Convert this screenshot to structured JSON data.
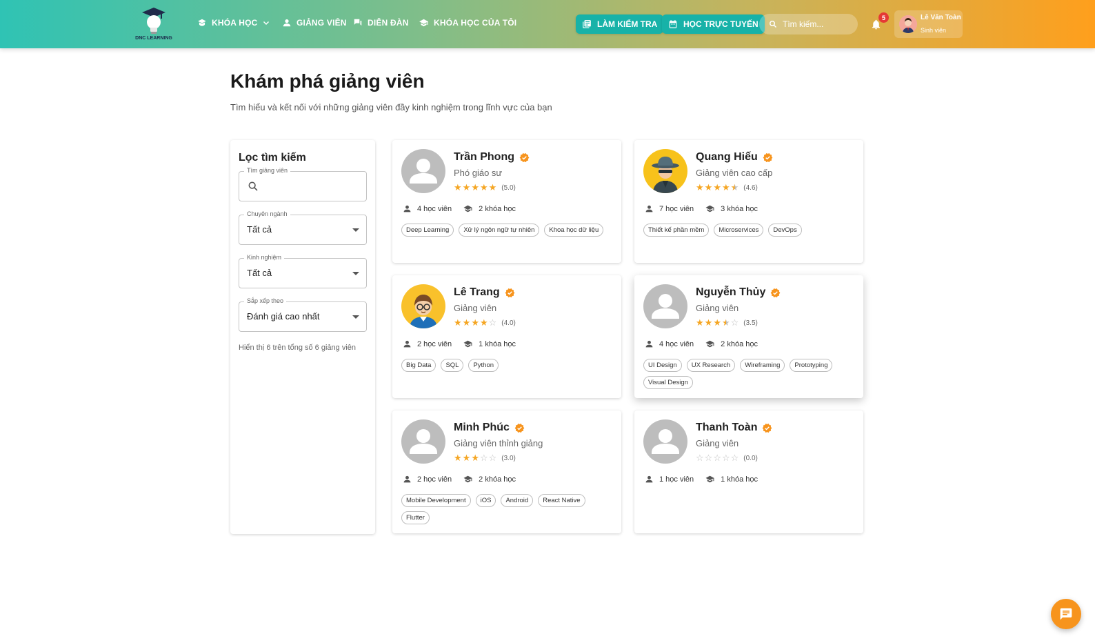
{
  "header": {
    "logo_text": "DNC LEARNING",
    "nav": [
      {
        "label": "KHÓA HỌC",
        "icon": "book-icon",
        "has_dropdown": true
      },
      {
        "label": "GIẢNG VIÊN",
        "icon": "person-icon"
      },
      {
        "label": "DIỄN ĐÀN",
        "icon": "forum-icon"
      },
      {
        "label": "KHÓA HỌC CỦA TÔI",
        "icon": "school-icon"
      }
    ],
    "btn_test": "LÀM KIỂM TRA",
    "btn_online": "HỌC TRỰC TUYẾN",
    "search_placeholder": "Tìm kiếm...",
    "notification_count": "5",
    "user": {
      "name": "Lê Văn Toàn",
      "role": "Sinh viên"
    }
  },
  "page": {
    "title": "Khám phá giảng viên",
    "subtitle": "Tìm hiểu và kết nối với những giảng viên đầy kinh nghiệm trong lĩnh vực của bạn"
  },
  "filter": {
    "title": "Lọc tìm kiếm",
    "search_label": "Tìm giảng viên",
    "specialty_label": "Chuyên ngành",
    "specialty_value": "Tất cả",
    "experience_label": "Kinh nghiệm",
    "experience_value": "Tất cả",
    "sort_label": "Sắp xếp theo",
    "sort_value": "Đánh giá cao nhất",
    "count_text": "Hiển thị 6 trên tổng số 6 giảng viên"
  },
  "colors": {
    "accent": "#f7941d",
    "star": "#f5a623",
    "teal": "#17b2a8"
  },
  "instructors": [
    {
      "name": "Trần Phong",
      "title": "Phó giáo sư",
      "rating": 5.0,
      "rating_text": "(5.0)",
      "students": "4 học viên",
      "courses": "2 khóa học",
      "tags": [
        "Deep Learning",
        "Xử lý ngôn ngữ tự nhiên",
        "Khoa học dữ liệu"
      ],
      "avatar": "generic"
    },
    {
      "name": "Quang Hiếu",
      "title": "Giảng viên cao cấp",
      "rating": 4.6,
      "rating_text": "(4.6)",
      "students": "7 học viên",
      "courses": "3 khóa học",
      "tags": [
        "Thiết kế phần mềm",
        "Microservices",
        "DevOps"
      ],
      "avatar": "spy"
    },
    {
      "name": "Lê Trang",
      "title": "Giảng viên",
      "rating": 4.0,
      "rating_text": "(4.0)",
      "students": "2 học viên",
      "courses": "1 khóa học",
      "tags": [
        "Big Data",
        "SQL",
        "Python"
      ],
      "avatar": "glasses"
    },
    {
      "name": "Nguyễn Thủy",
      "title": "Giảng viên",
      "rating": 3.5,
      "rating_text": "(3.5)",
      "students": "4 học viên",
      "courses": "2 khóa học",
      "tags": [
        "UI Design",
        "UX Research",
        "Wireframing",
        "Prototyping",
        "Visual Design"
      ],
      "avatar": "generic"
    },
    {
      "name": "Minh Phúc",
      "title": "Giảng viên thỉnh giảng",
      "rating": 3.0,
      "rating_text": "(3.0)",
      "students": "2 học viên",
      "courses": "2 khóa học",
      "tags": [
        "Mobile Development",
        "iOS",
        "Android",
        "React Native",
        "Flutter"
      ],
      "avatar": "generic"
    },
    {
      "name": "Thanh Toàn",
      "title": "Giảng viên",
      "rating": 0.0,
      "rating_text": "(0.0)",
      "students": "1 học viên",
      "courses": "1 khóa học",
      "tags": [],
      "avatar": "generic"
    }
  ]
}
